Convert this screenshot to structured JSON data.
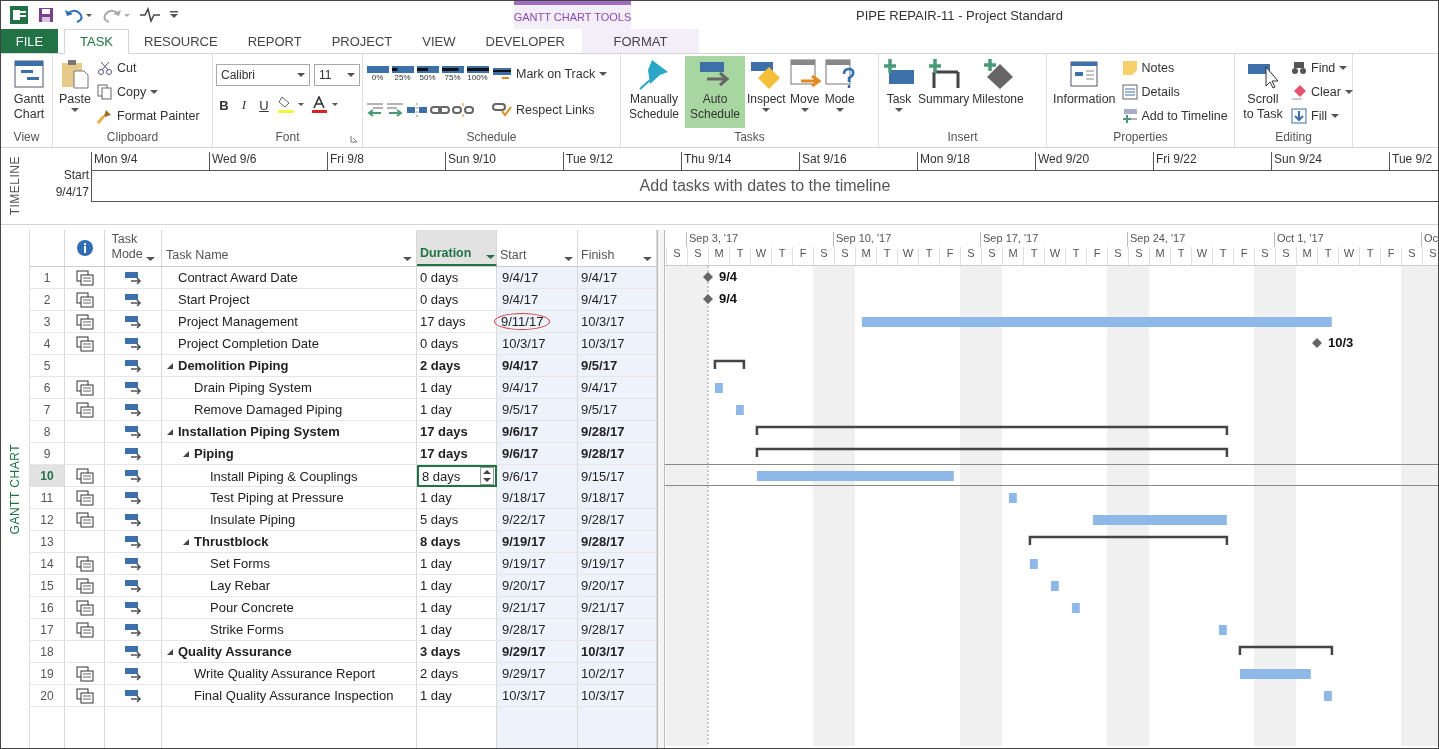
{
  "title_bar": {
    "title": "PIPE REPAIR-11 - Project Standard",
    "context_label": "GANTT CHART TOOLS"
  },
  "tabs": [
    {
      "label": "FILE",
      "kind": "file",
      "selected": false
    },
    {
      "label": "TASK",
      "kind": "normal",
      "selected": true
    },
    {
      "label": "RESOURCE",
      "kind": "normal",
      "selected": false
    },
    {
      "label": "REPORT",
      "kind": "normal",
      "selected": false
    },
    {
      "label": "PROJECT",
      "kind": "normal",
      "selected": false
    },
    {
      "label": "VIEW",
      "kind": "normal",
      "selected": false
    },
    {
      "label": "DEVELOPER",
      "kind": "normal",
      "selected": false
    },
    {
      "label": "FORMAT",
      "kind": "context",
      "selected": false
    }
  ],
  "ribbon": [
    {
      "kind": "view",
      "label": "View",
      "items": [
        {
          "label": "Gantt Chart"
        }
      ]
    },
    {
      "kind": "clipboard",
      "label": "Clipboard",
      "items": [
        {
          "label": "Paste"
        },
        {
          "label": "Cut"
        },
        {
          "label": "Copy"
        },
        {
          "label": "Format Painter"
        }
      ]
    },
    {
      "kind": "font",
      "label": "Font",
      "font": "Calibri",
      "size": "11",
      "items": [
        {
          "label": "B"
        },
        {
          "label": "I"
        },
        {
          "label": "U"
        }
      ]
    },
    {
      "kind": "schedule",
      "label": "Schedule",
      "percents": [
        "0%",
        "25%",
        "50%",
        "75%",
        "100%"
      ],
      "items": [
        {
          "label": "Mark on Track"
        },
        {
          "label": "Respect Links"
        }
      ]
    },
    {
      "kind": "tasks",
      "label": "Tasks",
      "items": [
        {
          "label": "Manually Schedule",
          "selected": false
        },
        {
          "label": "Auto Schedule",
          "selected": true
        },
        {
          "label": "Inspect",
          "selected": false
        },
        {
          "label": "Move",
          "selected": false
        },
        {
          "label": "Mode",
          "selected": false
        }
      ]
    },
    {
      "kind": "insert",
      "label": "Insert",
      "items": [
        {
          "label": "Task"
        },
        {
          "label": "Summary"
        },
        {
          "label": "Milestone"
        }
      ]
    },
    {
      "kind": "properties",
      "label": "Properties",
      "items": [
        {
          "label": "Information"
        },
        {
          "label": "Notes"
        },
        {
          "label": "Details"
        },
        {
          "label": "Add to Timeline"
        }
      ]
    },
    {
      "kind": "editing",
      "label": "Editing",
      "items": [
        {
          "label": "Scroll to Task"
        },
        {
          "label": "Find"
        },
        {
          "label": "Clear"
        },
        {
          "label": "Fill"
        }
      ]
    }
  ],
  "timeline": {
    "label": "TIMELINE",
    "start_label": "Start",
    "start_date": "9/4/17",
    "dates": [
      "Mon 9/4",
      "Wed 9/6",
      "Fri 9/8",
      "Sun 9/10",
      "Tue 9/12",
      "Thu 9/14",
      "Sat 9/16",
      "Mon 9/18",
      "Wed 9/20",
      "Fri 9/22",
      "Sun 9/24",
      "Tue 9/2"
    ],
    "message": "Add tasks with dates to the timeline"
  },
  "view_label": "GANTT CHART",
  "columns": [
    {
      "kind": "info",
      "selected": false
    },
    {
      "kind": "mode",
      "label": "Task Mode",
      "selected": false
    },
    {
      "kind": "name",
      "label": "Task Name",
      "selected": false
    },
    {
      "kind": "duration",
      "label": "Duration",
      "selected": true
    },
    {
      "kind": "start",
      "label": "Start",
      "selected": false
    },
    {
      "kind": "finish",
      "label": "Finish",
      "selected": false
    }
  ],
  "gantt": {
    "weeks": [
      "Sep 3, '17",
      "Sep 10, '17",
      "Sep 17, '17",
      "Sep 24, '17",
      "Oct 1, '17",
      "Oc"
    ],
    "days": [
      "S",
      "S",
      "M",
      "T",
      "W",
      "T",
      "F",
      "S",
      "S",
      "M",
      "T",
      "W",
      "T",
      "F",
      "S",
      "S",
      "M",
      "T",
      "W",
      "T",
      "F",
      "S",
      "S",
      "M",
      "T",
      "W",
      "T",
      "F",
      "S",
      "S",
      "M",
      "T",
      "W",
      "T",
      "F",
      "S",
      "S"
    ]
  },
  "tasks": [
    {
      "id": "1",
      "name": "Contract Award Date",
      "duration": "0 days",
      "start": "9/4/17",
      "finish": "9/4/17",
      "kind": "milestone",
      "indicator": true,
      "selected": false,
      "bar_label": "9/4"
    },
    {
      "id": "2",
      "name": "Start Project",
      "duration": "0 days",
      "start": "9/4/17",
      "finish": "9/4/17",
      "kind": "milestone",
      "indicator": true,
      "selected": false,
      "bar_label": "9/4"
    },
    {
      "id": "3",
      "name": "Project Management",
      "duration": "17 days",
      "start": "9/11/17",
      "finish": "10/3/17",
      "kind": "task",
      "indicator": true,
      "selected": false,
      "start_circled": true
    },
    {
      "id": "4",
      "name": "Project Completion Date",
      "duration": "0 days",
      "start": "10/3/17",
      "finish": "10/3/17",
      "kind": "milestone",
      "indicator": true,
      "selected": false,
      "bar_label": "10/3"
    },
    {
      "id": "5",
      "name": "Demolition Piping",
      "duration": "2 days",
      "start": "9/4/17",
      "finish": "9/5/17",
      "kind": "summary",
      "indicator": false,
      "selected": false,
      "expanded": true,
      "children": [
        {
          "id": "6",
          "name": "Drain Piping System",
          "duration": "1 day",
          "start": "9/4/17",
          "finish": "9/4/17",
          "kind": "task",
          "indicator": true,
          "selected": false
        },
        {
          "id": "7",
          "name": "Remove Damaged Piping",
          "duration": "1 day",
          "start": "9/5/17",
          "finish": "9/5/17",
          "kind": "task",
          "indicator": true,
          "selected": false
        }
      ]
    },
    {
      "id": "8",
      "name": "Installation Piping System",
      "duration": "17 days",
      "start": "9/6/17",
      "finish": "9/28/17",
      "kind": "summary",
      "indicator": false,
      "selected": false,
      "expanded": true,
      "children": [
        {
          "id": "9",
          "name": "Piping",
          "duration": "17 days",
          "start": "9/6/17",
          "finish": "9/28/17",
          "kind": "summary",
          "indicator": false,
          "selected": false,
          "expanded": true,
          "children": [
            {
              "id": "10",
              "name": "Install Piping & Couplings",
              "duration": "8 days",
              "start": "9/6/17",
              "finish": "9/15/17",
              "kind": "task",
              "indicator": true,
              "selected": true
            },
            {
              "id": "11",
              "name": "Test Piping at Pressure",
              "duration": "1 day",
              "start": "9/18/17",
              "finish": "9/18/17",
              "kind": "task",
              "indicator": true,
              "selected": false
            },
            {
              "id": "12",
              "name": "Insulate Piping",
              "duration": "5 days",
              "start": "9/22/17",
              "finish": "9/28/17",
              "kind": "task",
              "indicator": true,
              "selected": false
            }
          ]
        },
        {
          "id": "13",
          "name": "Thrustblock",
          "duration": "8 days",
          "start": "9/19/17",
          "finish": "9/28/17",
          "kind": "summary",
          "indicator": false,
          "selected": false,
          "expanded": true,
          "children": [
            {
              "id": "14",
              "name": "Set Forms",
              "duration": "1 day",
              "start": "9/19/17",
              "finish": "9/19/17",
              "kind": "task",
              "indicator": true,
              "selected": false
            },
            {
              "id": "15",
              "name": "Lay Rebar",
              "duration": "1 day",
              "start": "9/20/17",
              "finish": "9/20/17",
              "kind": "task",
              "indicator": true,
              "selected": false
            },
            {
              "id": "16",
              "name": "Pour Concrete",
              "duration": "1 day",
              "start": "9/21/17",
              "finish": "9/21/17",
              "kind": "task",
              "indicator": true,
              "selected": false
            },
            {
              "id": "17",
              "name": "Strike Forms",
              "duration": "1 day",
              "start": "9/28/17",
              "finish": "9/28/17",
              "kind": "task",
              "indicator": true,
              "selected": false
            }
          ]
        }
      ]
    },
    {
      "id": "18",
      "name": "Quality Assurance",
      "duration": "3 days",
      "start": "9/29/17",
      "finish": "10/3/17",
      "kind": "summary",
      "indicator": false,
      "selected": false,
      "expanded": true,
      "children": [
        {
          "id": "19",
          "name": "Write Quality Assurance Report",
          "duration": "2 days",
          "start": "9/29/17",
          "finish": "10/2/17",
          "kind": "task",
          "indicator": true,
          "selected": false
        },
        {
          "id": "20",
          "name": "Final Quality Assurance Inspection",
          "duration": "1 day",
          "start": "10/3/17",
          "finish": "10/3/17",
          "kind": "task",
          "indicator": true,
          "selected": false
        }
      ]
    }
  ]
}
